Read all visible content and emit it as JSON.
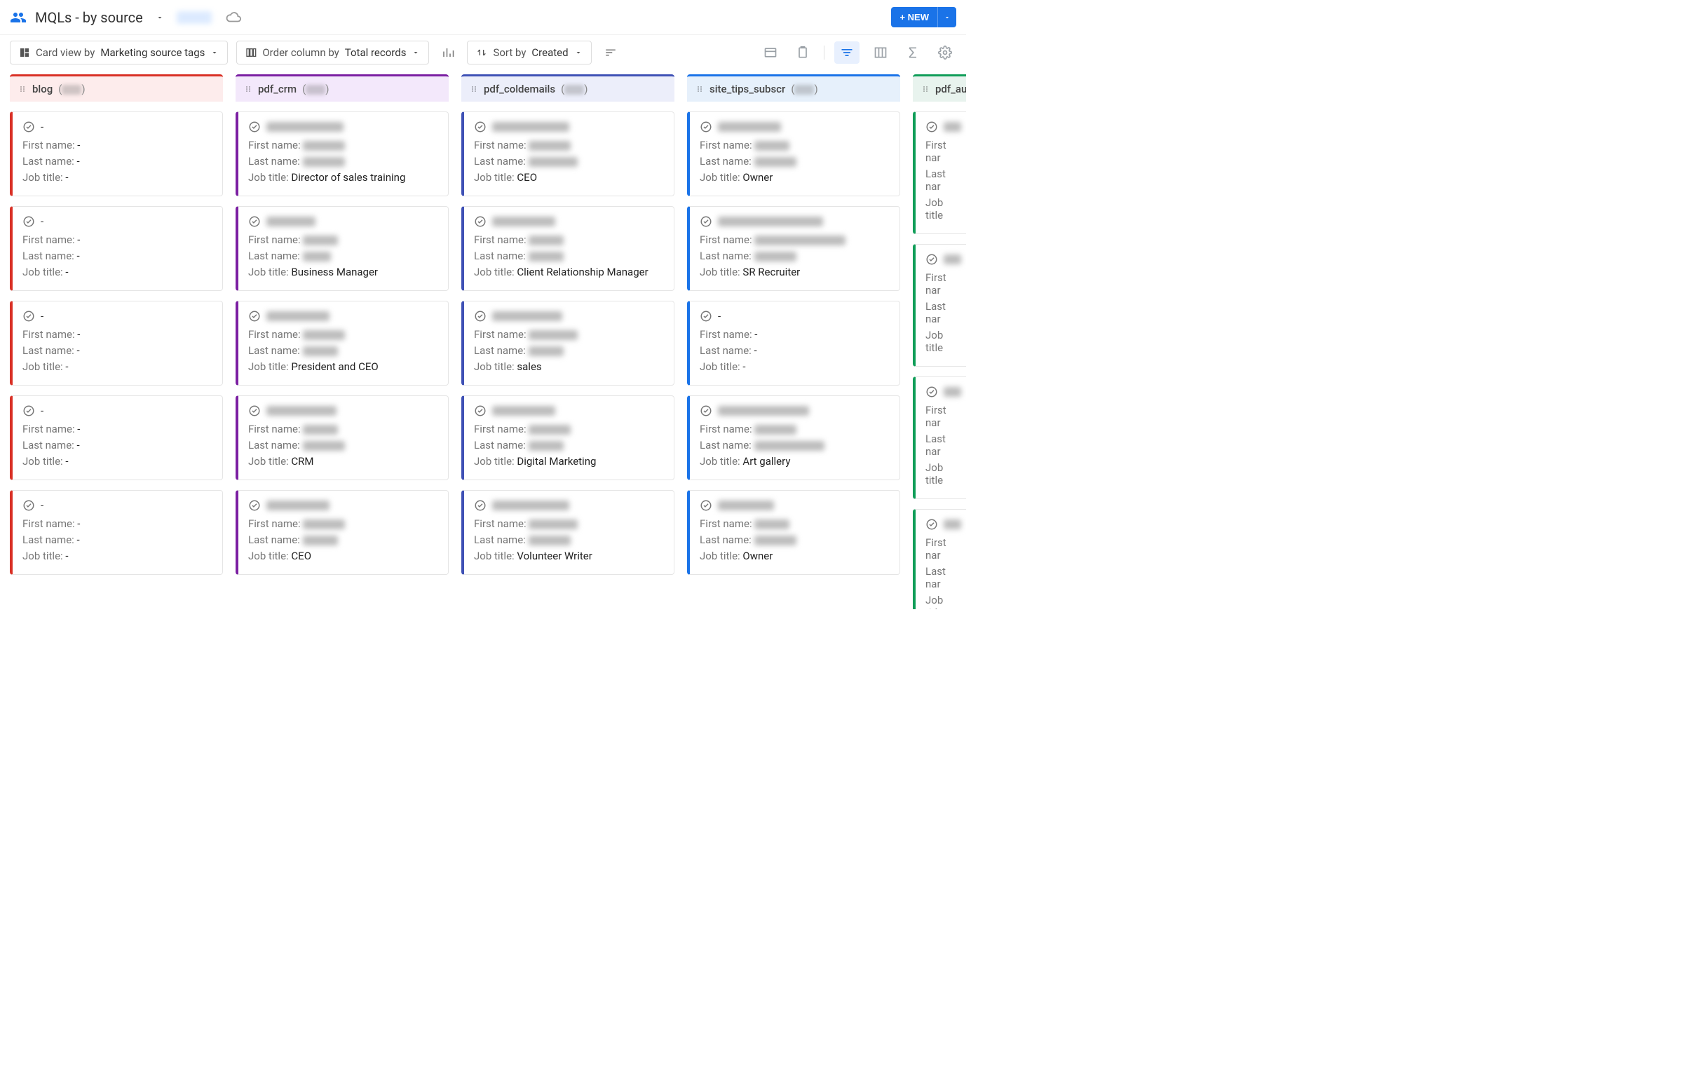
{
  "header": {
    "title": "MQLs - by source",
    "new_button": "+ NEW"
  },
  "toolbar": {
    "cardview_prefix": "Card view by",
    "cardview_value": "Marketing source tags",
    "ordercol_prefix": "Order column by",
    "ordercol_value": "Total records",
    "sortby_prefix": "Sort by",
    "sortby_value": "Created"
  },
  "field_labels": {
    "first_name": "First name:",
    "last_name": "Last name:",
    "job_title": "Job title:"
  },
  "columns": [
    {
      "id": "blog",
      "class": "col-blog",
      "name": "blog",
      "cards": [
        {
          "title": "-",
          "first": "-",
          "last": "-",
          "job": "-"
        },
        {
          "title": "-",
          "first": "-",
          "last": "-",
          "job": "-"
        },
        {
          "title": "-",
          "first": "-",
          "last": "-",
          "job": "-"
        },
        {
          "title": "-",
          "first": "-",
          "last": "-",
          "job": "-"
        },
        {
          "title": "-",
          "first": "-",
          "last": "-",
          "job": "-"
        }
      ]
    },
    {
      "id": "pdf_crm",
      "class": "col-pdfcrm",
      "name": "pdf_crm",
      "cards": [
        {
          "title_blur": 110,
          "first_blur": 60,
          "last_blur": 60,
          "job": "Director of sales training"
        },
        {
          "title_blur": 70,
          "first_blur": 50,
          "last_blur": 40,
          "job": "Business Manager"
        },
        {
          "title_blur": 90,
          "first_blur": 60,
          "last_blur": 50,
          "job": "President and CEO"
        },
        {
          "title_blur": 100,
          "first_blur": 50,
          "last_blur": 60,
          "job": "CRM"
        },
        {
          "title_blur": 90,
          "first_blur": 60,
          "last_blur": 50,
          "job": "CEO"
        }
      ]
    },
    {
      "id": "pdf_coldemails",
      "class": "col-cold",
      "name": "pdf_coldemails",
      "cards": [
        {
          "title_blur": 110,
          "first_blur": 60,
          "last_blur": 70,
          "job": "CEO"
        },
        {
          "title_blur": 90,
          "first_blur": 50,
          "last_blur": 50,
          "job": "Client Relationship Manager"
        },
        {
          "title_blur": 100,
          "first_blur": 70,
          "last_blur": 50,
          "job": "sales"
        },
        {
          "title_blur": 90,
          "first_blur": 60,
          "last_blur": 50,
          "job": "Digital Marketing"
        },
        {
          "title_blur": 110,
          "first_blur": 70,
          "last_blur": 60,
          "job": "Volunteer Writer"
        }
      ]
    },
    {
      "id": "site_tips_subscr",
      "class": "col-site",
      "name": "site_tips_subscr",
      "cards": [
        {
          "title_blur": 90,
          "first_blur": 50,
          "last_blur": 60,
          "job": "Owner"
        },
        {
          "title_blur": 150,
          "first_blur": 130,
          "last_blur": 60,
          "job": "SR Recruiter"
        },
        {
          "title": "-",
          "first": "-",
          "last": "-",
          "job": "-"
        },
        {
          "title_blur": 130,
          "first_blur": 60,
          "last_blur": 100,
          "job": "Art gallery"
        },
        {
          "title_blur": 80,
          "first_blur": 50,
          "last_blur": 60,
          "job": "Owner"
        }
      ]
    },
    {
      "id": "pdf_au",
      "class": "col-pdfau",
      "name": "pdf_au",
      "narrow": true,
      "cards": [
        {
          "title_blur": 40,
          "first_partial": "First nar",
          "last_partial": "Last nar",
          "job_partial": "Job title"
        },
        {
          "title_blur": 40,
          "first_partial": "First nar",
          "last_partial": "Last nar",
          "job_partial": "Job title"
        },
        {
          "title_blur": 40,
          "first_partial": "First nar",
          "last_partial": "Last nar",
          "job_partial": "Job title"
        },
        {
          "title_blur": 40,
          "first_partial": "First nar",
          "last_partial": "Last nar",
          "job_partial": "Job title"
        },
        {
          "title_blur": 40,
          "first_partial": "First nar",
          "last_partial": "Last nar",
          "job_partial": "Job title"
        }
      ]
    }
  ]
}
